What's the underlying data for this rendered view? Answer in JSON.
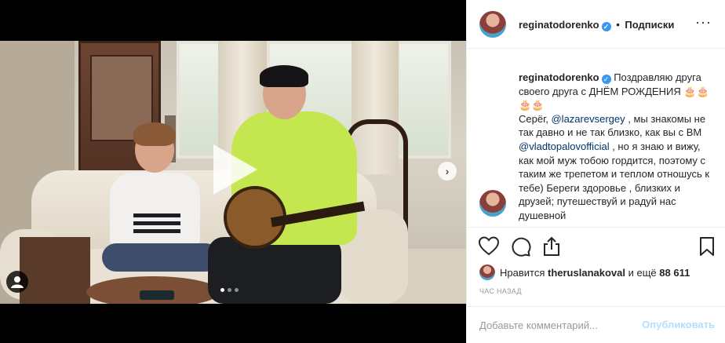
{
  "post": {
    "username": "reginatodorenko",
    "separator": "•",
    "follow_label": "Подписки",
    "more_icon": "more-options-icon",
    "caption": {
      "username": "reginatodorenko",
      "line1": "Поздравляю друга своего друга с ДНЁМ РОЖДЕНИЯ 🎂🎂🎂🎂",
      "line2_pre": "Серёг,",
      "mention1": "@lazarevsergey",
      "line2_post": ", мы знакомы не так давно и не так близко, как вы с ВМ",
      "mention2": "@vladtopalovofficial",
      "line3": ", но я знаю и вижу, как мой муж тобою гордится, поэтому с таким же трепетом и теплом отношусь к тебе) Береги здоровье , близких и друзей; путешествуй и радуй нас душевной"
    },
    "likes": {
      "prefix": "Нравится",
      "user": "theruslanakoval",
      "suffix": "и ещё",
      "count": "88 611"
    },
    "time": "час назад",
    "comment_placeholder": "Добавьте комментарий...",
    "post_label": "Опубликовать",
    "carousel_next": "›",
    "carousel_pages": 3,
    "carousel_active": 1
  },
  "colors": {
    "link": "#003569",
    "verified": "#3897f0",
    "post_disabled": "#b2dffc"
  }
}
